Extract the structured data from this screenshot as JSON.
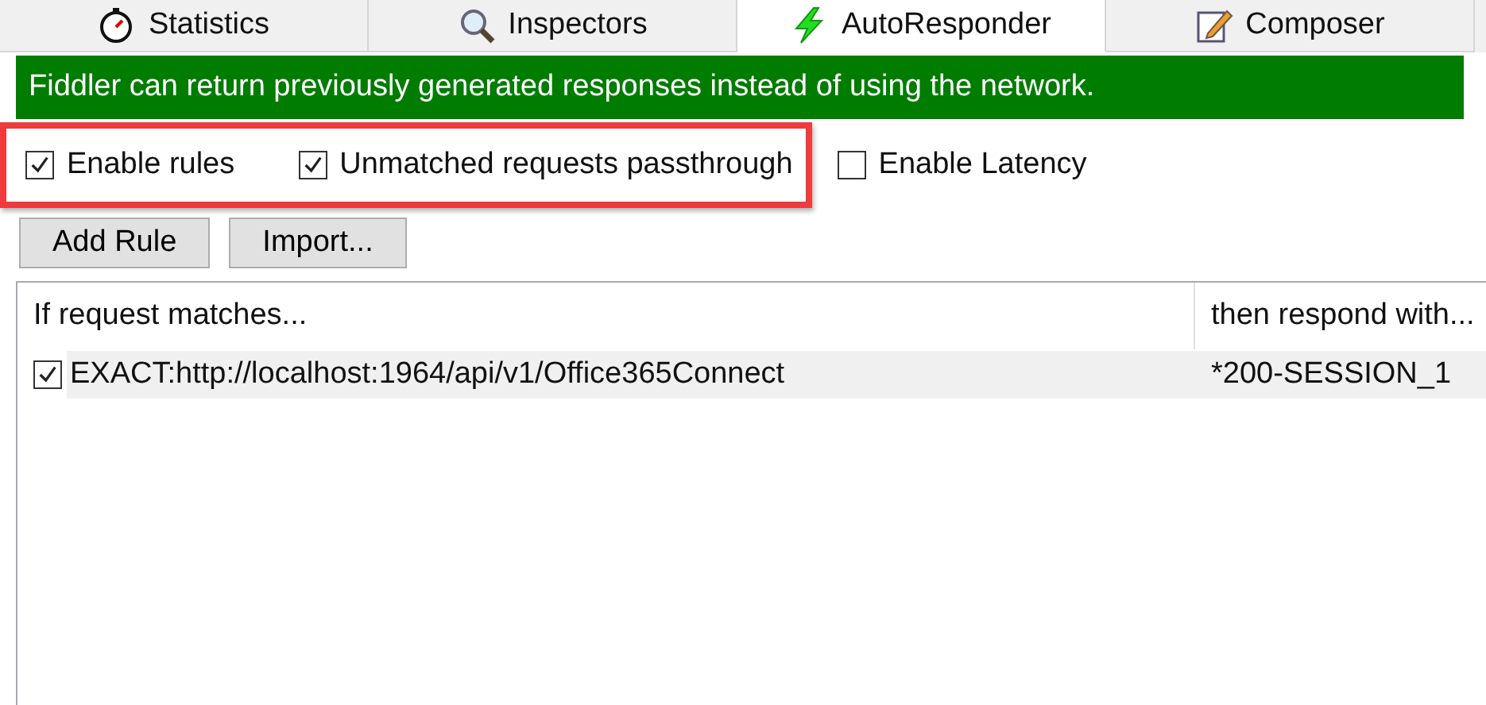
{
  "tabs": [
    {
      "label": "Statistics",
      "selected": false
    },
    {
      "label": "Inspectors",
      "selected": false
    },
    {
      "label": "AutoResponder",
      "selected": true
    },
    {
      "label": "Composer",
      "selected": false
    }
  ],
  "banner": "Fiddler can return previously generated responses instead of using the network.",
  "options": [
    {
      "label": "Enable rules",
      "checked": true,
      "highlighted": true
    },
    {
      "label": "Unmatched requests passthrough",
      "checked": true,
      "highlighted": true
    },
    {
      "label": "Enable Latency",
      "checked": false,
      "highlighted": false
    }
  ],
  "buttons": [
    "Add Rule",
    "Import..."
  ],
  "table": {
    "columns": [
      "If request matches...",
      "then respond with..."
    ],
    "rows": [
      {
        "checked": true,
        "selected": true,
        "cells": [
          "EXACT:http://localhost:1964/api/v1/Office365Connect",
          "*200-SESSION_1"
        ]
      }
    ]
  }
}
